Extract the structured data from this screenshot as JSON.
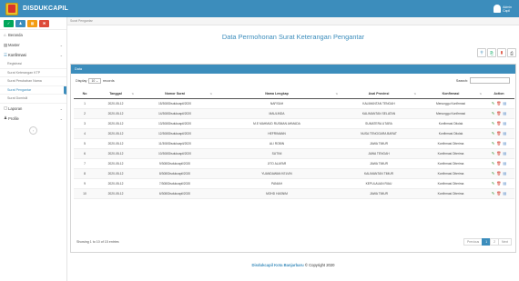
{
  "app": {
    "title": "DISDUKCAPIL",
    "user_name": "Admin\nCapil"
  },
  "sidebar": {
    "items": [
      {
        "icon": "home-icon",
        "glyph": "⌂",
        "label": "Beranda"
      },
      {
        "icon": "folder-icon",
        "glyph": "▤",
        "label": "Master"
      },
      {
        "icon": "list-icon",
        "glyph": "☰",
        "label": "Konfirmasi"
      }
    ],
    "sub_items": [
      "Registrasi",
      "Surat Keterangan KTP",
      "Surat Perubahan Nama",
      "Surat Pengantar",
      "Surat Domisili"
    ],
    "bottom_items": [
      {
        "icon": "file-icon",
        "glyph": "▢",
        "label": "Laporan"
      },
      {
        "icon": "user-icon",
        "glyph": "♟",
        "label": "Profile"
      }
    ]
  },
  "breadcrumb": "Surat Pengantar",
  "page": {
    "title": "Data Permohonan Surat Keterangan Pengantar"
  },
  "card": {
    "header": "Data",
    "show_label": "Display",
    "page_size": "10",
    "records_label": "records",
    "search_label": "Search:"
  },
  "table": {
    "columns": [
      "No",
      "Tanggal",
      "Nomor Surat",
      "Nama Lengkap",
      "Asal Provinsi",
      "Konfirmasi",
      "Action"
    ],
    "rows": [
      [
        "1",
        "2020-05-12",
        "15/308/Disdukcapil/2020",
        "NAFISAH",
        "KALIMANTAN TENGAH",
        "Menunggu Konfirmasi"
      ],
      [
        "2",
        "2020-05-12",
        "14/308/Disdukcapil/2020",
        "MAULINDA",
        "KALIMANTAN SELATAN",
        "Menunggu Konfirmasi"
      ],
      [
        "3",
        "2020-05-12",
        "13/308/Disdukcapil/2020",
        "M.E MAHMUD RUSMAN AHMADA",
        "SUMATERA UTARA",
        "Konfirmasi Ditolak"
      ],
      [
        "4",
        "2020-05-12",
        "12/308/Disdukcapil/2020",
        "HEFRIMANN",
        "NUSA TENGGARA BARAT",
        "Konfirmasi Ditolak"
      ],
      [
        "5",
        "2020-05-12",
        "11/308/Disdukcapil/2020",
        "ALI ROBIN",
        "JAWA TIMUR",
        "Konfirmasi Diterima"
      ],
      [
        "6",
        "2020-05-12",
        "10/308/Disdukcapil/2020",
        "SUTINI",
        "JAWA TENGAH",
        "Konfirmasi Diterima"
      ],
      [
        "7",
        "2020-05-12",
        "9/308/Disdukcapil/2020",
        "JITO ALAFAR",
        "JAWA TIMUR",
        "Konfirmasi Diterima"
      ],
      [
        "8",
        "2020-05-12",
        "8/308/Disdukcapil/2020",
        "YUANDAWAN KELVIN",
        "KALIMANTAN TIMUR",
        "Konfirmasi Diterima"
      ],
      [
        "9",
        "2020-05-12",
        "7/308/Disdukcapil/2020",
        "PANIAH",
        "KEPULAUAN RIAU",
        "Konfirmasi Diterima"
      ],
      [
        "10",
        "2020-05-12",
        "6/308/Disdukcapil/2020",
        "MOHD HASNIM",
        "JAWA TIMUR",
        "Konfirmasi Diterima"
      ]
    ],
    "actions": [
      "✎",
      "🗑",
      "▤"
    ]
  },
  "pagination": {
    "info": "Showing 1 to 10 of 15 entries",
    "prev": "Previous",
    "pages": [
      "1",
      "2"
    ],
    "next": "Next"
  },
  "footer": {
    "brand": "Disdukcapil Kota Banjarbaru",
    "copyright": " © Copyright 2020"
  },
  "colors": {
    "primary": "#3c8dbc"
  }
}
